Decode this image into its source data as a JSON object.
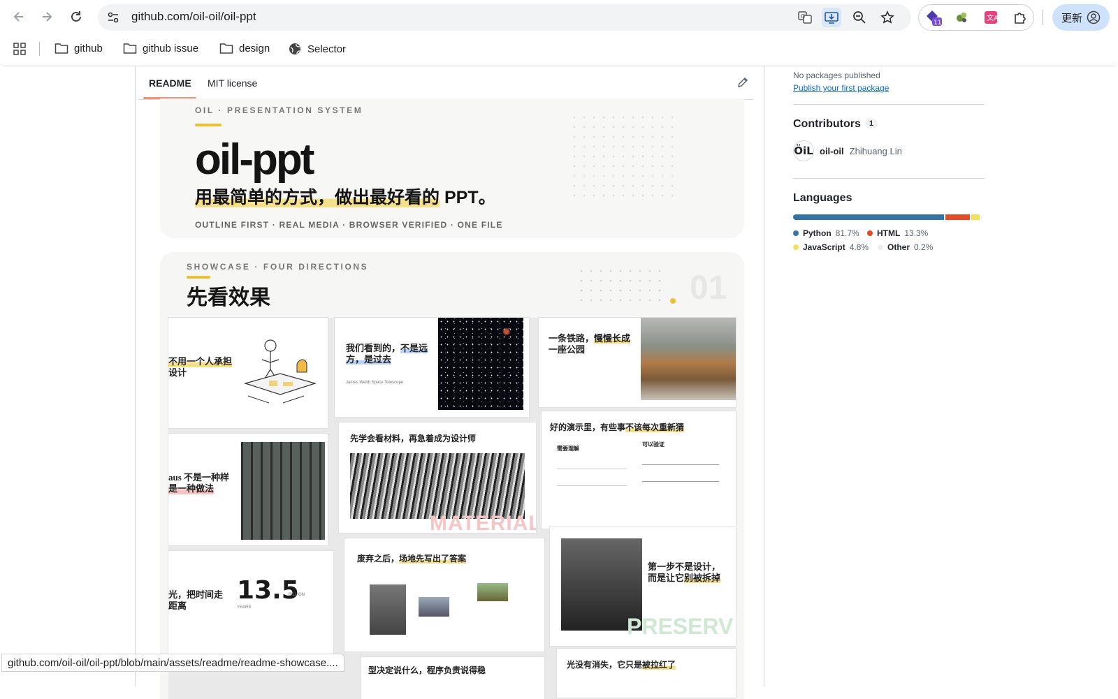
{
  "browser": {
    "url": "github.com/oil-oil/oil-ppt",
    "update_label": "更新",
    "status_url": "github.com/oil-oil/oil-ppt/blob/main/assets/readme/readme-showcase....",
    "extension_badge": "11"
  },
  "bookmarks": [
    {
      "label": "github",
      "icon": "folder-icon"
    },
    {
      "label": "github issue",
      "icon": "folder-icon"
    },
    {
      "label": "design",
      "icon": "folder-icon"
    },
    {
      "label": "Selector",
      "icon": "globe-icon"
    }
  ],
  "readme_tabs": {
    "readme": "README",
    "license": "MIT license"
  },
  "hero": {
    "kicker": "OIL · PRESENTATION SYSTEM",
    "title": "oil-ppt",
    "subtitle_pre": "用最简单的方式，",
    "subtitle_hl": "做出最好看的",
    "subtitle_post": " PPT。",
    "footer": "OUTLINE FIRST · REAL MEDIA · BROWSER VERIFIED · ONE FILE"
  },
  "showcase": {
    "kicker": "SHOWCASE · FOUR DIRECTIONS",
    "title": "先看效果",
    "number": "01",
    "cards": {
      "c1_title_a": "不用一个人承担",
      "c1_title_b": "设计",
      "c2_title_a": "我们看到的，",
      "c2_title_hl": "不是远方，是过去",
      "c2_sub": "James Webb Space Telescope",
      "c3_title_a": "一条铁路，",
      "c3_title_hl": "慢慢长成",
      "c3_title_b": "一座公园",
      "c4_title_a": "aus 不是一种样",
      "c4_title_b": "是一种做法",
      "c5_title": "先学会看材料，再急着成为设计师",
      "c5_overlay": "MATERIAL",
      "c6_title_a": "好的演示里，有些事",
      "c6_title_hl": "不该每次重新猜",
      "c6_col_a": "需要理解",
      "c6_col_b": "可以验证",
      "c7_title_a": "光，把时间走",
      "c7_title_b": "距离",
      "c7_big": "13.5",
      "c7_unit": "BILLION",
      "c7_unit2": "YEARS",
      "c8_title_a": "废弃之后，",
      "c8_title_hl": "场地先写出了答案",
      "c9_title_a": "第一步不是设计，",
      "c9_title_b": "而是让它",
      "c9_title_hl": "别被拆掉",
      "c9_overlay": "PRESERV",
      "c10_title": "型决定说什么，程序负责说得稳",
      "c11_title_a": "光没有消失，它只是",
      "c11_title_hl": "被拉红了"
    }
  },
  "sidebar": {
    "packages_text": "No packages published",
    "packages_link": "Publish your first package",
    "contributors_title": "Contributors",
    "contributors_count": "1",
    "contributor_login": "oil-oil",
    "contributor_name": "Zhihuang Lin",
    "languages_title": "Languages",
    "languages": [
      {
        "name": "Python",
        "percent": "81.7%",
        "value": 81.7,
        "color": "#3572A5"
      },
      {
        "name": "HTML",
        "percent": "13.3%",
        "value": 13.3,
        "color": "#e34c26"
      },
      {
        "name": "JavaScript",
        "percent": "4.8%",
        "value": 4.8,
        "color": "#f1e05a"
      },
      {
        "name": "Other",
        "percent": "0.2%",
        "value": 0.2,
        "color": "#ededed"
      }
    ]
  }
}
